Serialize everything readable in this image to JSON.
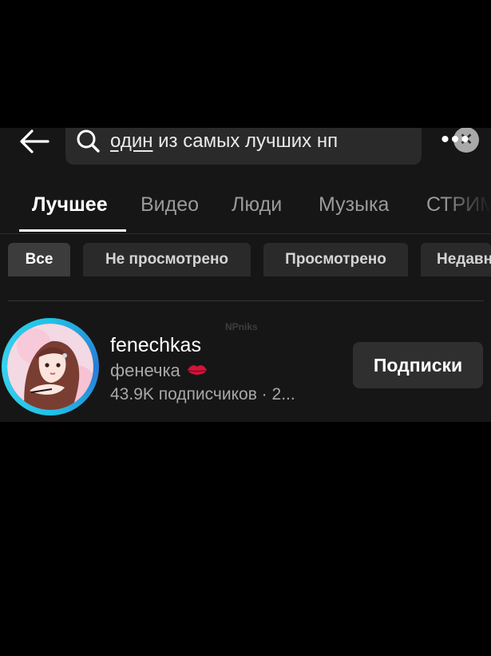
{
  "search": {
    "query_underlined": "один",
    "query_rest": " из самых лучших нп",
    "clear_label": "✕",
    "more_label": "•••"
  },
  "tabs": [
    {
      "label": "Лучшее",
      "active": true
    },
    {
      "label": "Видео",
      "active": false
    },
    {
      "label": "Люди",
      "active": false
    },
    {
      "label": "Музыка",
      "active": false
    },
    {
      "label": "СТРИМ",
      "active": false
    }
  ],
  "chips": [
    {
      "label": "Все",
      "active": true
    },
    {
      "label": "Не просмотрено",
      "active": false
    },
    {
      "label": "Просмотрено",
      "active": false
    },
    {
      "label": "Недавн",
      "active": false
    }
  ],
  "watermark": "NPniks",
  "result": {
    "username": "fenechkas",
    "nickname": "фенечка",
    "meta": "43.9K подписчиков · 2...",
    "follow_label": "Подписки"
  },
  "colors": {
    "background": "#000000",
    "surface": "#161616",
    "chip": "#2a2a2a",
    "avatar_ring": "#1fc3e6",
    "lips": "#d4143a"
  },
  "icons": [
    "back-arrow-icon",
    "search-icon",
    "clear-icon",
    "more-icon",
    "lips-icon"
  ]
}
